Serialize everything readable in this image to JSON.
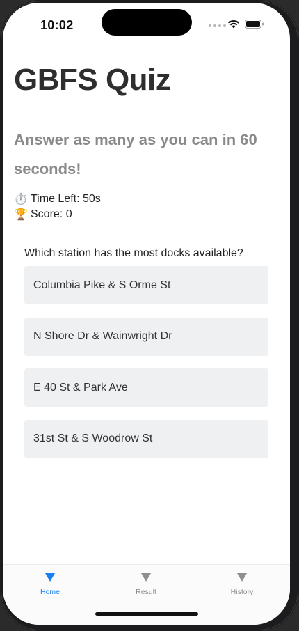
{
  "status_bar": {
    "time": "10:02"
  },
  "header": {
    "title": "GBFS Quiz",
    "subtitle": "Answer as many as you can in 60 seconds!"
  },
  "stats": {
    "time_emoji": "⏱️",
    "time_left": "Time Left: 50s",
    "score_emoji": "🏆",
    "score": "Score: 0"
  },
  "quiz": {
    "question": "Which station has the most docks available?",
    "options": [
      "Columbia Pike & S Orme St",
      "N Shore Dr & Wainwright Dr",
      "E 40 St & Park Ave",
      "31st St & S Woodrow St"
    ]
  },
  "tabbar": {
    "tabs": [
      {
        "label": "Home",
        "icon": "triangle-down-icon",
        "active": true
      },
      {
        "label": "Result",
        "icon": "triangle-down-icon",
        "active": false
      },
      {
        "label": "History",
        "icon": "triangle-down-icon",
        "active": false
      }
    ]
  },
  "colors": {
    "accent": "#1a7ff0",
    "title": "#2e2e2e",
    "subtitle": "#8a8a8a",
    "option_bg": "#eff0f2"
  }
}
